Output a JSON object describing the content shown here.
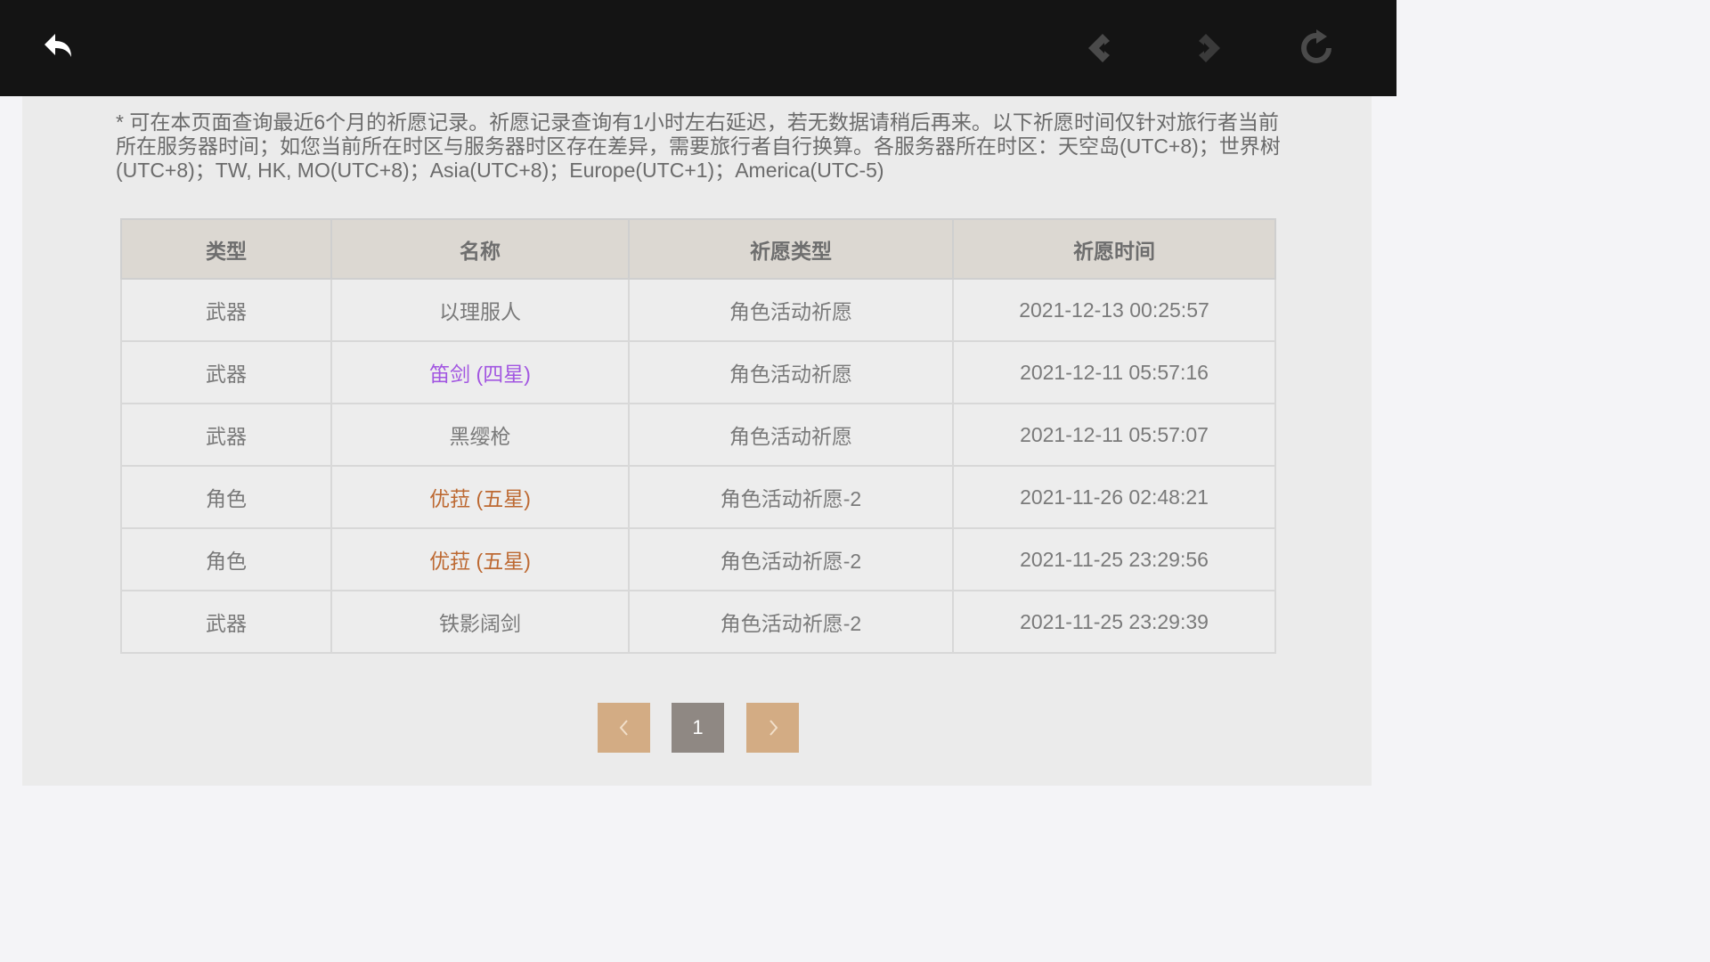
{
  "toolbar": {
    "back_icon": "back-arrow-icon",
    "prev_icon": "nav-back-icon",
    "forward_icon": "nav-forward-icon",
    "refresh_icon": "refresh-icon"
  },
  "notice": "* 可在本页面查询最近6个月的祈愿记录。祈愿记录查询有1小时左右延迟，若无数据请稍后再来。以下祈愿时间仅针对旅行者当前所在服务器时间；如您当前所在时区与服务器时区存在差异，需要旅行者自行换算。各服务器所在时区：天空岛(UTC+8)；世界树(UTC+8)；TW, HK, MO(UTC+8)；Asia(UTC+8)；Europe(UTC+1)；America(UTC-5)",
  "table": {
    "headers": [
      "类型",
      "名称",
      "祈愿类型",
      "祈愿时间"
    ],
    "rows": [
      {
        "type": "武器",
        "name": "以理服人",
        "wish_type": "角色活动祈愿",
        "time": "2021-12-13 00:25:57",
        "rarity_color": "#7a7a7a"
      },
      {
        "type": "武器",
        "name": "笛剑 (四星)",
        "wish_type": "角色活动祈愿",
        "time": "2021-12-11 05:57:16",
        "rarity_color": "#a256e1"
      },
      {
        "type": "武器",
        "name": "黑缨枪",
        "wish_type": "角色活动祈愿",
        "time": "2021-12-11 05:57:07",
        "rarity_color": "#7a7a7a"
      },
      {
        "type": "角色",
        "name": "优菈 (五星)",
        "wish_type": "角色活动祈愿-2",
        "time": "2021-11-26 02:48:21",
        "rarity_color": "#bd6932"
      },
      {
        "type": "角色",
        "name": "优菈 (五星)",
        "wish_type": "角色活动祈愿-2",
        "time": "2021-11-25 23:29:56",
        "rarity_color": "#bd6932"
      },
      {
        "type": "武器",
        "name": "铁影阔剑",
        "wish_type": "角色活动祈愿-2",
        "time": "2021-11-25 23:29:39",
        "rarity_color": "#7a7a7a"
      }
    ]
  },
  "pagination": {
    "prev_icon": "chevron-left-icon",
    "current_page": "1",
    "next_icon": "chevron-right-icon"
  },
  "colors": {
    "topbar": "#141414",
    "content_bg": "#ebebeb",
    "header_bg": "#dcd8d2",
    "pager_nav": "#d3ac84",
    "pager_page": "#8f8883",
    "four_star": "#a256e1",
    "five_star": "#bd6932"
  }
}
